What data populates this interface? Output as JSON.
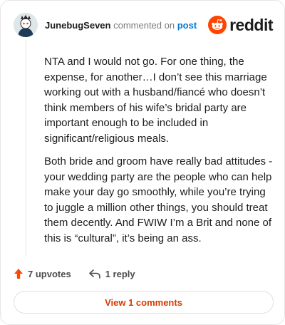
{
  "comment": {
    "author": "JunebugSeven",
    "action_text": "commented on",
    "link_text": "post",
    "paragraphs": [
      "NTA and I would not go. For one thing, the expense, for another…I don’t see this marriage working out with a husband/fiancé who doesn’t think members of his wife’s bridal party are important enough to be included in significant/religious meals.",
      "Both bride and groom have really bad attitudes - your wedding party are the people who can help make your day go smoothly, while you’re trying to juggle a million other things, you should treat them decently. And FWIW I’m a Brit and none of this is “cultural”, it’s being an ass."
    ],
    "upvotes_label": "7 upvotes",
    "reply_label": "1 reply",
    "view_comments_label": "View 1 comments"
  },
  "brand": {
    "name": "reddit",
    "accent": "#ff4500"
  },
  "icons": {
    "avatar": "snoo-avatar",
    "logo": "reddit-snoo-icon",
    "upvote": "upvote-arrow-icon",
    "reply": "reply-arrow-icon"
  },
  "colors": {
    "link": "#0079d3",
    "action": "#d93a00",
    "muted": "#7c7c7c"
  }
}
